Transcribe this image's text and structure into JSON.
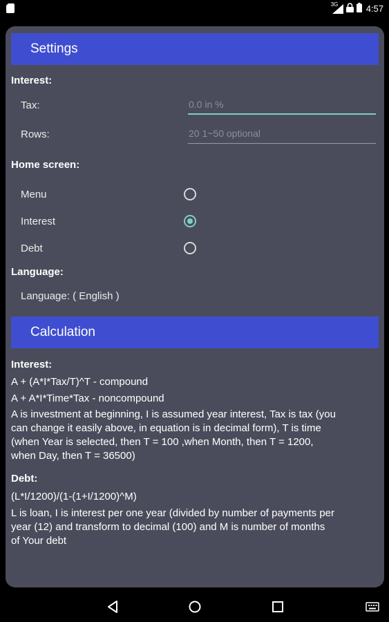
{
  "status_bar": {
    "time": "4:57",
    "network": "3G",
    "icons": [
      "sim-card-icon",
      "signal-icon",
      "lock-icon",
      "battery-icon"
    ]
  },
  "settings": {
    "header": "Settings",
    "interest_label": "Interest:",
    "tax_label": "Tax:",
    "tax_value": "0.0  in %",
    "rows_label": "Rows:",
    "rows_value": "20  1~50 optional",
    "home_screen_label": "Home screen:",
    "home_options": [
      {
        "label": "Menu",
        "checked": false
      },
      {
        "label": "Interest",
        "checked": true
      },
      {
        "label": "Debt",
        "checked": false
      }
    ],
    "language_label": "Language:",
    "language_value": "Language: ( English )"
  },
  "calculation": {
    "header": "Calculation",
    "interest_label": "Interest:",
    "formula_compound": "A + (A*I*Tax/T)^T - compound",
    "formula_noncompound": "A + A*I*Time*Tax - noncompound",
    "interest_description": "A is investment at beginning, I is assumed year interest, Tax is tax (you can change it easily above, in equation is in decimal form), T is time (when Year is selected, then T = 100 ,when Month, then T = 1200, when Day, then T = 36500)",
    "debt_label": "Debt:",
    "debt_formula": "(L*I/1200)/(1-(1+I/1200)^M)",
    "debt_description": "L is loan, I is interest per one year (divided by number of payments per year (12) and transform to decimal (100) and M is number of months of Your debt"
  },
  "colors": {
    "header_bg": "#3f4ed0",
    "dialog_bg": "#4b4c5b",
    "accent": "#7fcfc1"
  },
  "nav_bar": {
    "icons": [
      "back-icon",
      "home-icon",
      "recents-icon",
      "keyboard-icon"
    ]
  }
}
